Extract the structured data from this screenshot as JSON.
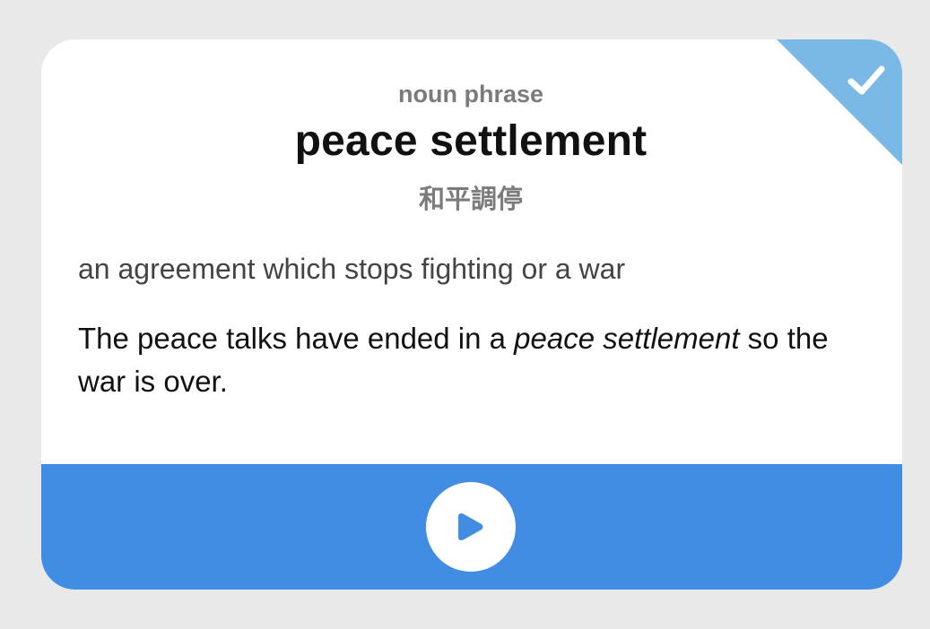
{
  "card": {
    "word_type": "noun phrase",
    "headword": "peace settlement",
    "translation": "和平調停",
    "definition": "an agreement which stops fighting or a war",
    "example": {
      "before": "The peace talks have ended in a ",
      "highlight": "peace settlement",
      "after": " so the war is over."
    }
  },
  "badge": {
    "icon": "checkmark-icon",
    "state": "checked",
    "color": "#7ab8e6"
  },
  "audio": {
    "icon": "play-icon",
    "bar_color": "#418de4"
  }
}
